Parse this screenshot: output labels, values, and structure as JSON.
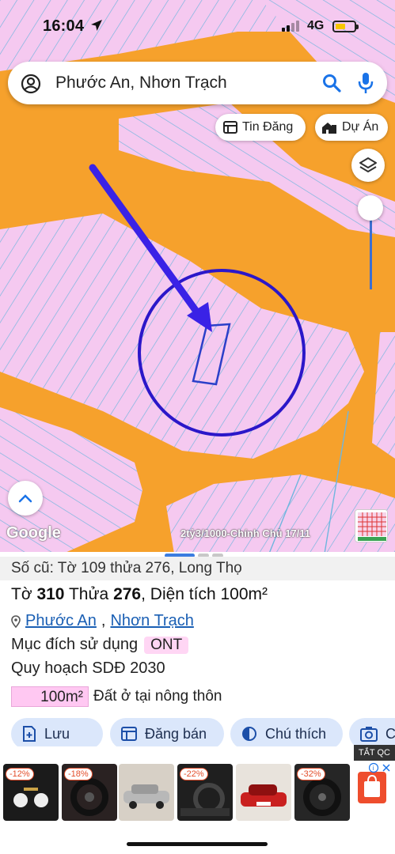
{
  "status": {
    "time": "16:04",
    "network": "4G"
  },
  "search": {
    "query": "Phước An, Nhơn Trạch"
  },
  "chips": {
    "tin_dang": "Tin Đăng",
    "du_an": "Dự Án"
  },
  "map": {
    "provider": "Google",
    "listing_label": "2tỷ3/1000-Chính Chủ 17/11",
    "colors": {
      "road": "#f6a12c",
      "parcel": "#f5c9f0",
      "parcel_line": "#6fb6de",
      "highlight_circle": "#2b17c9",
      "arrow": "#3a22e6"
    }
  },
  "parcel": {
    "old_ref": "Số cũ: Tờ 109 thửa 276, Long Thọ",
    "title_prefix": "Tờ",
    "sheet_no": "310",
    "parcel_word": "Thửa",
    "parcel_no": "276",
    "area_label": ", Diện tích",
    "area_value": "100m²",
    "ward": "Phước An",
    "district": "Nhơn Trạch",
    "separator": ",",
    "purpose_label": "Mục đích sử dụng",
    "purpose_code": "ONT",
    "plan_label": "Quy hoạch SDĐ 2030",
    "plan_area": "100m²",
    "plan_type": "Đất ở tại nông thôn"
  },
  "actions": {
    "save": "Lưu",
    "sell": "Đăng bán",
    "legend": "Chú thích",
    "more": "C"
  },
  "ads": {
    "badge": "TẮT QC",
    "items": [
      {
        "discount": "-12%",
        "color": "#1b1b1b"
      },
      {
        "discount": "-18%",
        "color": "#2a2222"
      },
      {
        "discount": "",
        "color": "#d7d0c6"
      },
      {
        "discount": "-22%",
        "color": "#1f1f1f"
      },
      {
        "discount": "",
        "color": "#c9201f"
      },
      {
        "discount": "-32%",
        "color": "#262626"
      }
    ]
  }
}
